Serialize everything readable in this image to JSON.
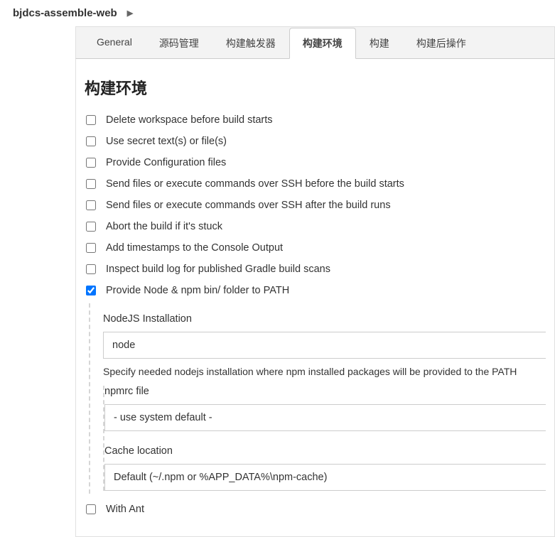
{
  "breadcrumb": {
    "project": "bjdcs-assemble-web"
  },
  "tabs": [
    {
      "id": "general",
      "label": "General",
      "active": false
    },
    {
      "id": "scm",
      "label": "源码管理",
      "active": false
    },
    {
      "id": "triggers",
      "label": "构建触发器",
      "active": false
    },
    {
      "id": "env",
      "label": "构建环境",
      "active": true
    },
    {
      "id": "build",
      "label": "构建",
      "active": false
    },
    {
      "id": "post",
      "label": "构建后操作",
      "active": false
    }
  ],
  "section": {
    "title": "构建环境"
  },
  "checks": [
    {
      "id": "delete-ws",
      "label": "Delete workspace before build starts",
      "checked": false
    },
    {
      "id": "use-secret",
      "label": "Use secret text(s) or file(s)",
      "checked": false
    },
    {
      "id": "provide-config",
      "label": "Provide Configuration files",
      "checked": false
    },
    {
      "id": "ssh-before",
      "label": "Send files or execute commands over SSH before the build starts",
      "checked": false
    },
    {
      "id": "ssh-after",
      "label": "Send files or execute commands over SSH after the build runs",
      "checked": false
    },
    {
      "id": "abort-stuck",
      "label": "Abort the build if it's stuck",
      "checked": false
    },
    {
      "id": "timestamps",
      "label": "Add timestamps to the Console Output",
      "checked": false
    },
    {
      "id": "gradle-scan",
      "label": "Inspect build log for published Gradle build scans",
      "checked": false
    },
    {
      "id": "node-path",
      "label": "Provide Node & npm bin/ folder to PATH",
      "checked": true
    }
  ],
  "node": {
    "install_label": "NodeJS Installation",
    "install_value": "node",
    "install_help": "Specify needed nodejs installation where npm installed packages will be provided to the PATH",
    "npmrc_label": "npmrc file",
    "npmrc_value": "- use system default -",
    "cache_label": "Cache location",
    "cache_value": "Default (~/.npm or %APP_DATA%\\npm-cache)"
  },
  "with_ant": {
    "label": "With Ant",
    "checked": false
  }
}
